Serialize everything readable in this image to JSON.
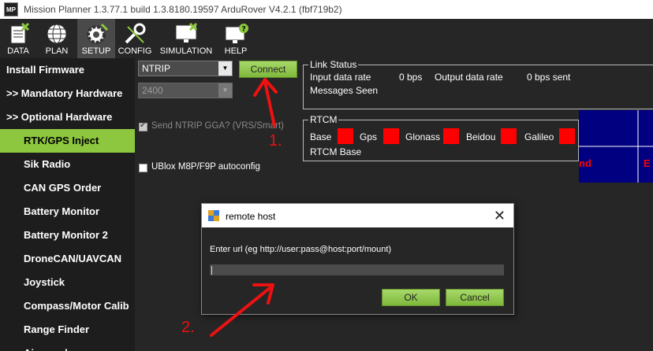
{
  "window": {
    "app_icon_text": "MP",
    "title": "Mission Planner 1.3.77.1 build 1.3.8180.19597 ArduRover V4.2.1 (fbf719b2)"
  },
  "toolbar": {
    "buttons": [
      {
        "label": "DATA",
        "icon": "data-icon"
      },
      {
        "label": "PLAN",
        "icon": "globe-icon"
      },
      {
        "label": "SETUP",
        "icon": "gear-icon",
        "active": true
      },
      {
        "label": "CONFIG",
        "icon": "wrench-icon"
      },
      {
        "label": "SIMULATION",
        "icon": "monitor-icon"
      },
      {
        "label": "HELP",
        "icon": "help-icon"
      }
    ]
  },
  "sidebar": {
    "items": [
      {
        "label": "Install Firmware"
      },
      {
        "label": ">> Mandatory Hardware"
      },
      {
        "label": ">> Optional Hardware"
      },
      {
        "label": "RTK/GPS Inject",
        "selected": true
      },
      {
        "label": "Sik Radio"
      },
      {
        "label": "CAN GPS Order"
      },
      {
        "label": "Battery Monitor"
      },
      {
        "label": "Battery Monitor 2"
      },
      {
        "label": "DroneCAN/UAVCAN"
      },
      {
        "label": "Joystick"
      },
      {
        "label": "Compass/Motor Calib"
      },
      {
        "label": "Range Finder"
      },
      {
        "label": "Airspeed"
      }
    ]
  },
  "rtk": {
    "port_value": "NTRIP",
    "baud_value": "2400",
    "connect_label": "Connect",
    "send_gga_label": "Send NTRIP GGA? (VRS/Smart)",
    "send_gga_checked": true,
    "ublox_label": "UBlox M8P/F9P autoconfig",
    "ublox_checked": false
  },
  "link_status": {
    "title": "Link Status",
    "input_label": "Input data rate",
    "input_value": "0 bps",
    "output_label": "Output data rate",
    "output_value": "0 bps sent",
    "messages_label": "Messages Seen"
  },
  "rtcm": {
    "title": "RTCM",
    "items": [
      "Base",
      "Gps",
      "Glonass",
      "Beidou",
      "Galileo"
    ],
    "status_color": "#ff0000",
    "base_label": "RTCM Base"
  },
  "background_panel": {
    "fragment1": "nd",
    "fragment2": "E"
  },
  "dialog": {
    "title": "remote host",
    "close_glyph": "✕",
    "prompt": "Enter url (eg http://user:pass@host:port/mount)",
    "input_value": "",
    "ok_label": "OK",
    "cancel_label": "Cancel"
  },
  "annotations": {
    "step1": "1.",
    "step2": "2.",
    "color": "#ee1111"
  },
  "colors": {
    "accent": "#8dc63f",
    "background": "#262626",
    "blue_panel": "#000080"
  }
}
